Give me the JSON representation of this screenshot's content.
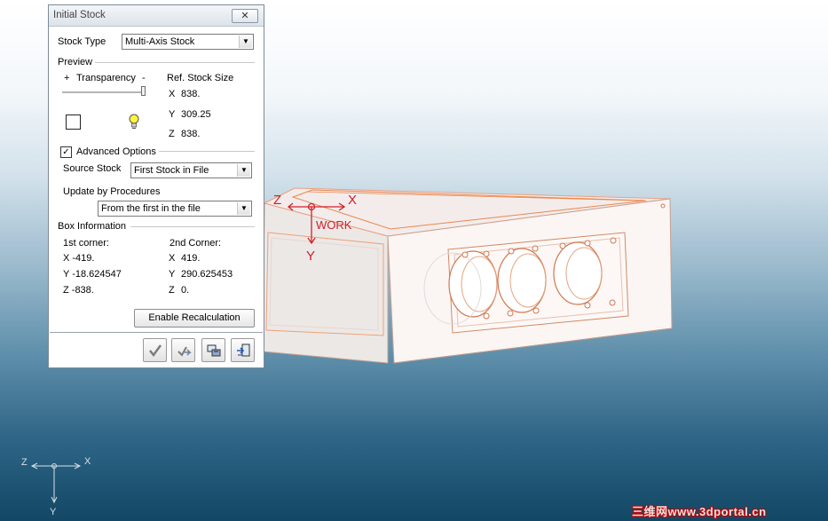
{
  "dialog": {
    "title": "Initial Stock",
    "close_glyph": "✕",
    "stock_type_label": "Stock Type",
    "stock_type_value": "Multi-Axis Stock",
    "preview_label": "Preview",
    "transparency_plus": "+",
    "transparency_label": "Transparency",
    "transparency_minus": "-",
    "ref_size_label": "Ref. Stock Size",
    "ref_size": {
      "x_label": "X",
      "x": "838.",
      "y_label": "Y",
      "y": "309.25",
      "z_label": "Z",
      "z": "838."
    },
    "advanced_checked": true,
    "advanced_label": "Advanced Options",
    "source_stock_label": "Source Stock",
    "source_stock_value": "First Stock in File",
    "update_label": "Update by Procedures",
    "update_value": "From the first in the file",
    "box_info_label": "Box Information",
    "corner1_label": "1st corner:",
    "corner1": {
      "x": "X -419.",
      "y": "Y -18.624547",
      "z": "Z -838."
    },
    "corner2_label": "2nd Corner:",
    "corner2": {
      "x_label": "X",
      "x": "419.",
      "y_label": "Y",
      "y": "290.625453",
      "z_label": "Z",
      "z": "0."
    },
    "recalc_button": "Enable Recalculation",
    "toolbar_icons": [
      "checkmark-icon",
      "apply-arrows-icon",
      "preview-icon",
      "exit-icon"
    ]
  },
  "viewport": {
    "work_label": "WORK",
    "axis_z": "Z",
    "axis_x": "X",
    "axis_y": "Y",
    "triad_z": "Z",
    "triad_x": "X",
    "triad_y": "Y",
    "accent_color": "#e04010"
  },
  "watermark": "三维网www.3dportal.cn"
}
